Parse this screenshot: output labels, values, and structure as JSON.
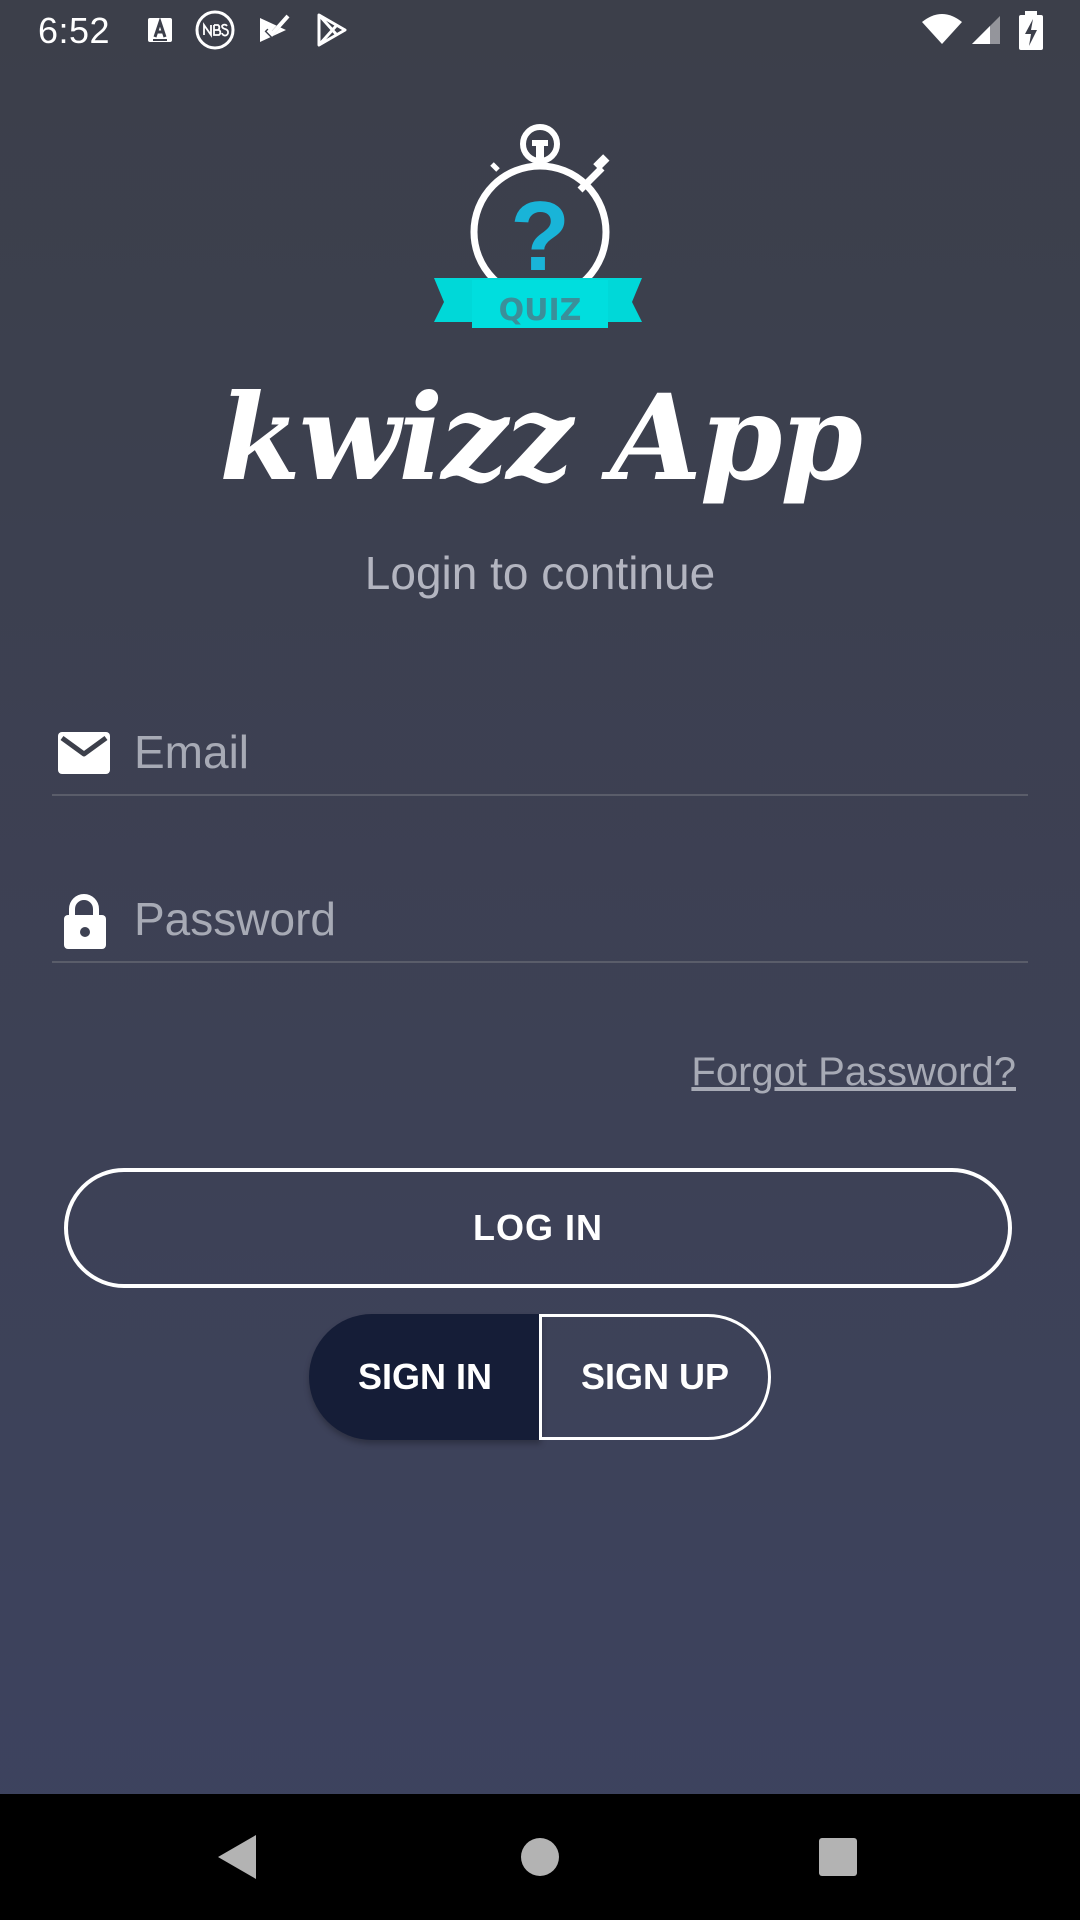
{
  "status_bar": {
    "time": "6:52",
    "left_icons": [
      "text-a-icon",
      "nbs-icon",
      "check-flag-icon",
      "play-store-icon"
    ],
    "right_icons": [
      "wifi-icon",
      "cell-signal-icon",
      "battery-charging-icon"
    ]
  },
  "logo": {
    "badge_text": "QUIZ",
    "question_mark": "?",
    "accent_color": "#00d8d8",
    "question_color": "#19b4d8"
  },
  "app": {
    "title": "kwizz App",
    "subtitle": "Login to continue"
  },
  "form": {
    "email": {
      "placeholder": "Email",
      "value": "",
      "icon": "mail-icon"
    },
    "password": {
      "placeholder": "Password",
      "value": "",
      "icon": "lock-icon"
    },
    "forgot_label": "Forgot Password?",
    "login_label": "LOG IN"
  },
  "segmented": {
    "sign_in_label": "SIGN IN",
    "sign_up_label": "SIGN UP",
    "selected": "SIGN IN"
  },
  "nav_bar": {
    "buttons": [
      "back-icon",
      "home-icon",
      "recents-icon"
    ]
  },
  "colors": {
    "background_top": "#3c3f4a",
    "background_bottom": "#3d4360",
    "selected_segment": "#151d37",
    "muted_text": "#a7aab5"
  }
}
